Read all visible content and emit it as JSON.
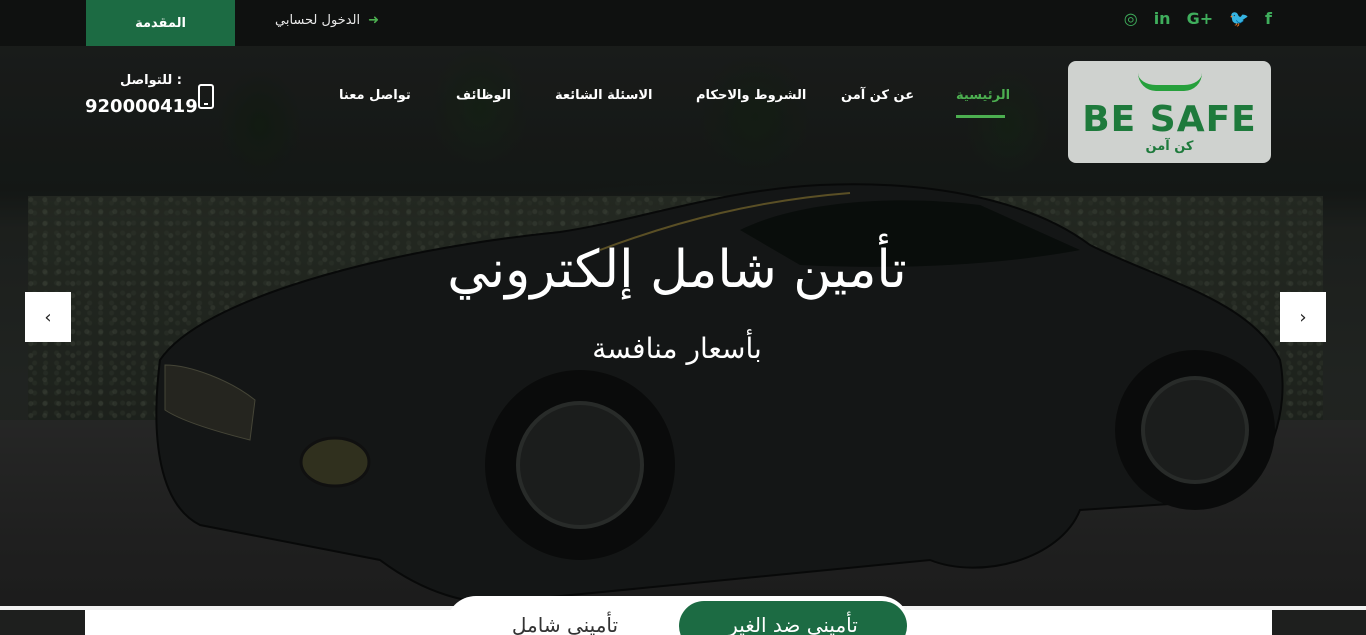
{
  "topbar": {
    "cta_label": "المقدمة",
    "login_label": "الدخول لحسابي",
    "social_icons": [
      "instagram-icon",
      "linkedin-icon",
      "google-plus-icon",
      "twitter-icon",
      "facebook-icon"
    ],
    "social_glyphs": [
      "◎",
      "in",
      "G+",
      "🐦",
      "f"
    ]
  },
  "logo": {
    "brand": "BE SAFE",
    "tagline": "كن آمن"
  },
  "nav": {
    "items": [
      "الرئيسية",
      "عن كن آمن",
      "الشروط والاحكام",
      "الاسئلة الشائعة",
      "الوظائف",
      "تواصل معنا"
    ]
  },
  "contact": {
    "label": "للتواصل :",
    "phone": "920000419"
  },
  "hero": {
    "title": "تأمين شامل إلكتروني",
    "subtitle": "بأسعار منافسة",
    "prev_glyph": "‹",
    "next_glyph": "›"
  },
  "tabs": {
    "active": "تأميني ضد الغير",
    "inactive": "تأميني شامل"
  },
  "colors": {
    "brand_green": "#1c6b43",
    "accent_green": "#4caf50"
  }
}
